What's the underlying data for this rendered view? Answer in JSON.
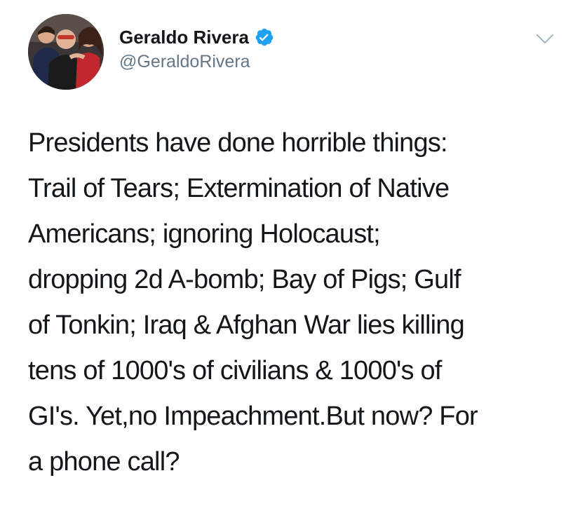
{
  "author": {
    "display_name": "Geraldo Rivera",
    "handle": "@GeraldoRivera",
    "verified": true,
    "verified_color": "#1da1f2",
    "avatar_icon": "profile-photo"
  },
  "menu": {
    "icon": "chevron-down-icon"
  },
  "tweet": {
    "lines": [
      "Presidents have done horrible things:",
      "Trail of Tears; Extermination of Native",
      "Americans; ignoring Holocaust;",
      "dropping 2d A-bomb; Bay of Pigs; Gulf",
      "of Tonkin; Iraq & Afghan War lies killing",
      "tens of 1000's of civilians & 1000's of",
      "GI's. Yet,no Impeachment.But now? For",
      "a phone call?"
    ]
  }
}
